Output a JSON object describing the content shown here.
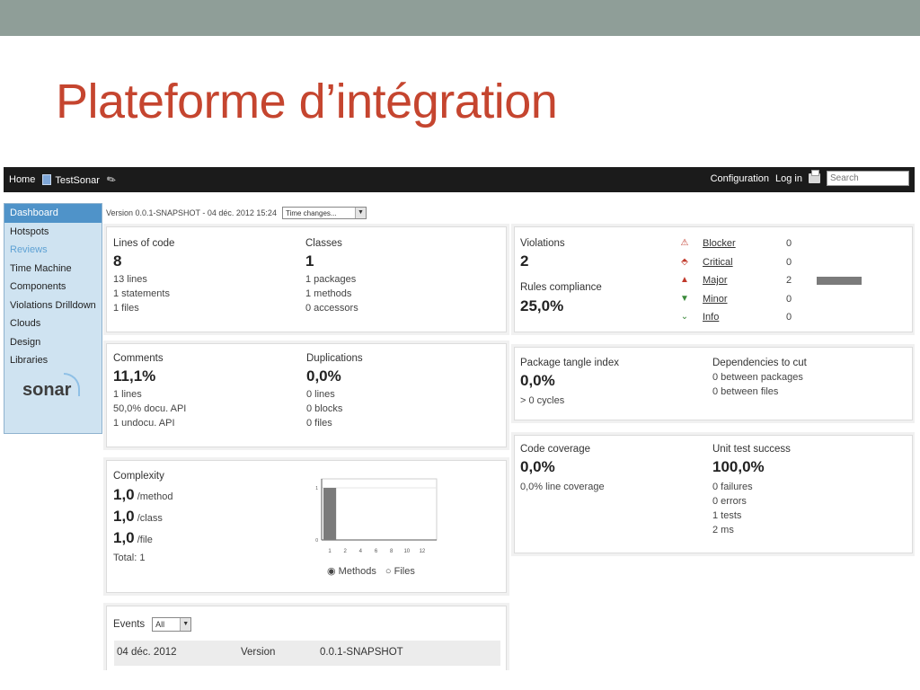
{
  "slide": {
    "title": "Plateforme d’intégration"
  },
  "header": {
    "home": "Home",
    "project": "TestSonar",
    "configuration": "Configuration",
    "login": "Log in",
    "search_placeholder": "Search"
  },
  "sidebar": {
    "items": [
      {
        "label": "Dashboard",
        "state": "active"
      },
      {
        "label": "Hotspots",
        "state": ""
      },
      {
        "label": "Reviews",
        "state": "muted"
      },
      {
        "label": "Time Machine",
        "state": ""
      },
      {
        "label": "Components",
        "state": ""
      },
      {
        "label": "Violations Drilldown",
        "state": ""
      },
      {
        "label": "Clouds",
        "state": ""
      },
      {
        "label": "Design",
        "state": ""
      },
      {
        "label": "Libraries",
        "state": ""
      }
    ],
    "logo": "sonar"
  },
  "version": {
    "text": "Version 0.0.1-SNAPSHOT - 04 déc. 2012 15:24",
    "time_changes": "Time changes..."
  },
  "loc": {
    "label": "Lines of code",
    "value": "8",
    "lines": "13 lines",
    "statements": "1 statements",
    "files": "1 files"
  },
  "classes": {
    "label": "Classes",
    "value": "1",
    "packages": "1 packages",
    "methods": "1 methods",
    "accessors": "0 accessors"
  },
  "comments": {
    "label": "Comments",
    "value": "11,1%",
    "lines": "1 lines",
    "docu": "50,0% docu. API",
    "undocu": "1 undocu. API"
  },
  "duplications": {
    "label": "Duplications",
    "value": "0,0%",
    "lines": "0 lines",
    "blocks": "0 blocks",
    "files": "0 files"
  },
  "complexity": {
    "label": "Complexity",
    "per_method": "1,0",
    "per_method_unit": "/method",
    "per_class": "1,0",
    "per_class_unit": "/class",
    "per_file": "1,0",
    "per_file_unit": "/file",
    "total": "Total: 1",
    "radio_methods": "Methods",
    "radio_files": "Files"
  },
  "chart_data": {
    "type": "bar",
    "categories": [
      "1",
      "2",
      "4",
      "6",
      "8",
      "10",
      "12"
    ],
    "values": [
      1,
      0,
      0,
      0,
      0,
      0,
      0
    ],
    "ylim": [
      0,
      1
    ],
    "yticks": [
      "0",
      "1"
    ],
    "bar_color": "#7b7b7b"
  },
  "violations": {
    "label": "Violations",
    "value": "2",
    "compliance_label": "Rules compliance",
    "compliance_value": "25,0%",
    "severities": [
      {
        "name": "Blocker",
        "count": "0",
        "icon": "blocker-icon",
        "color": "#c0392b",
        "glyph": "⚠",
        "fraction": 0
      },
      {
        "name": "Critical",
        "count": "0",
        "icon": "critical-icon",
        "color": "#c0392b",
        "glyph": "⬘",
        "fraction": 0
      },
      {
        "name": "Major",
        "count": "2",
        "icon": "major-icon",
        "color": "#c0392b",
        "glyph": "▲",
        "fraction": 1
      },
      {
        "name": "Minor",
        "count": "0",
        "icon": "minor-icon",
        "color": "#3a8a3a",
        "glyph": "▼",
        "fraction": 0
      },
      {
        "name": "Info",
        "count": "0",
        "icon": "info-icon",
        "color": "#3a8a3a",
        "glyph": "⌄",
        "fraction": 0
      }
    ]
  },
  "tangle": {
    "label": "Package tangle index",
    "value": "0,0%",
    "cycles": "> 0 cycles",
    "deps_label": "Dependencies to cut",
    "between_packages": "0 between packages",
    "between_files": "0 between files"
  },
  "coverage": {
    "label": "Code coverage",
    "value": "0,0%",
    "line_coverage": "0,0% line coverage",
    "tests_label": "Unit test success",
    "tests_value": "100,0%",
    "failures": "0 failures",
    "errors": "0 errors",
    "tests": "1 tests",
    "duration": "2 ms"
  },
  "events": {
    "label": "Events",
    "filter": "All",
    "rows": [
      {
        "date": "04 déc. 2012",
        "category": "Version",
        "name": "0.0.1-SNAPSHOT"
      }
    ]
  }
}
